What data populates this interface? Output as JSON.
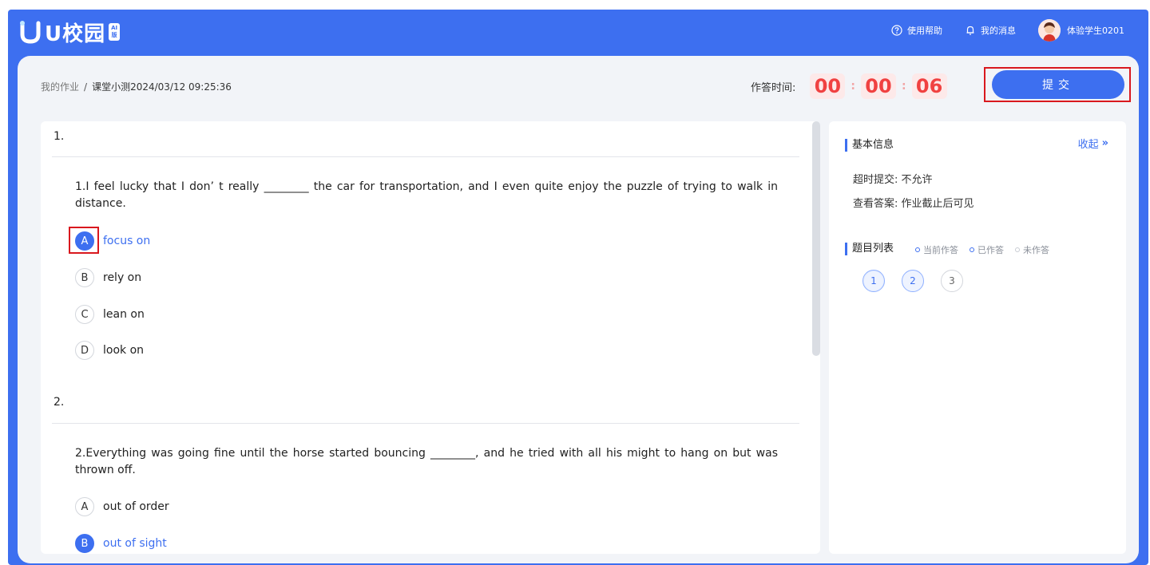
{
  "brand": {
    "name": "U校园",
    "sub_top": "AI",
    "sub_bottom": "版"
  },
  "topbar": {
    "help": "使用帮助",
    "messages": "我的消息",
    "user_name": "体验学生0201"
  },
  "breadcrumb": {
    "parent": "我的作业",
    "separator": "/",
    "current": "课堂小测2024/03/12 09:25:36"
  },
  "timer": {
    "label": "作答时间:",
    "hours": "00",
    "minutes": "00",
    "seconds": "06",
    "colon": ":"
  },
  "submit_label": "提交",
  "questions": [
    {
      "number": "1.",
      "text": "1.I feel lucky that I don’ t really ________ the car for transportation, and I even quite enjoy the puzzle of trying to walk in distance.",
      "options": [
        {
          "letter": "A",
          "label": "focus on",
          "selected": true
        },
        {
          "letter": "B",
          "label": "rely on",
          "selected": false
        },
        {
          "letter": "C",
          "label": "lean on",
          "selected": false
        },
        {
          "letter": "D",
          "label": "look on",
          "selected": false
        }
      ]
    },
    {
      "number": "2.",
      "text": "2.Everything was going fine until the horse started bouncing ________, and he tried with all his might to hang on but was thrown off.",
      "options": [
        {
          "letter": "A",
          "label": "out of order",
          "selected": false
        },
        {
          "letter": "B",
          "label": "out of sight",
          "selected": true
        }
      ]
    }
  ],
  "side": {
    "basic_info_title": "基本信息",
    "collapse_label": "收起",
    "collapse_icon": "»",
    "timeout_label": "超时提交:",
    "timeout_value": "不允许",
    "answer_label": "查看答案:",
    "answer_value": "作业截止后可见",
    "list_title": "题目列表",
    "legend_current": "当前作答",
    "legend_done": "已作答",
    "legend_undone": "未作答",
    "question_buttons": [
      "1",
      "2",
      "3"
    ]
  },
  "colors": {
    "primary": "#3d6ff0",
    "timer_red": "#f04141",
    "highlight_red": "#d9181e"
  }
}
